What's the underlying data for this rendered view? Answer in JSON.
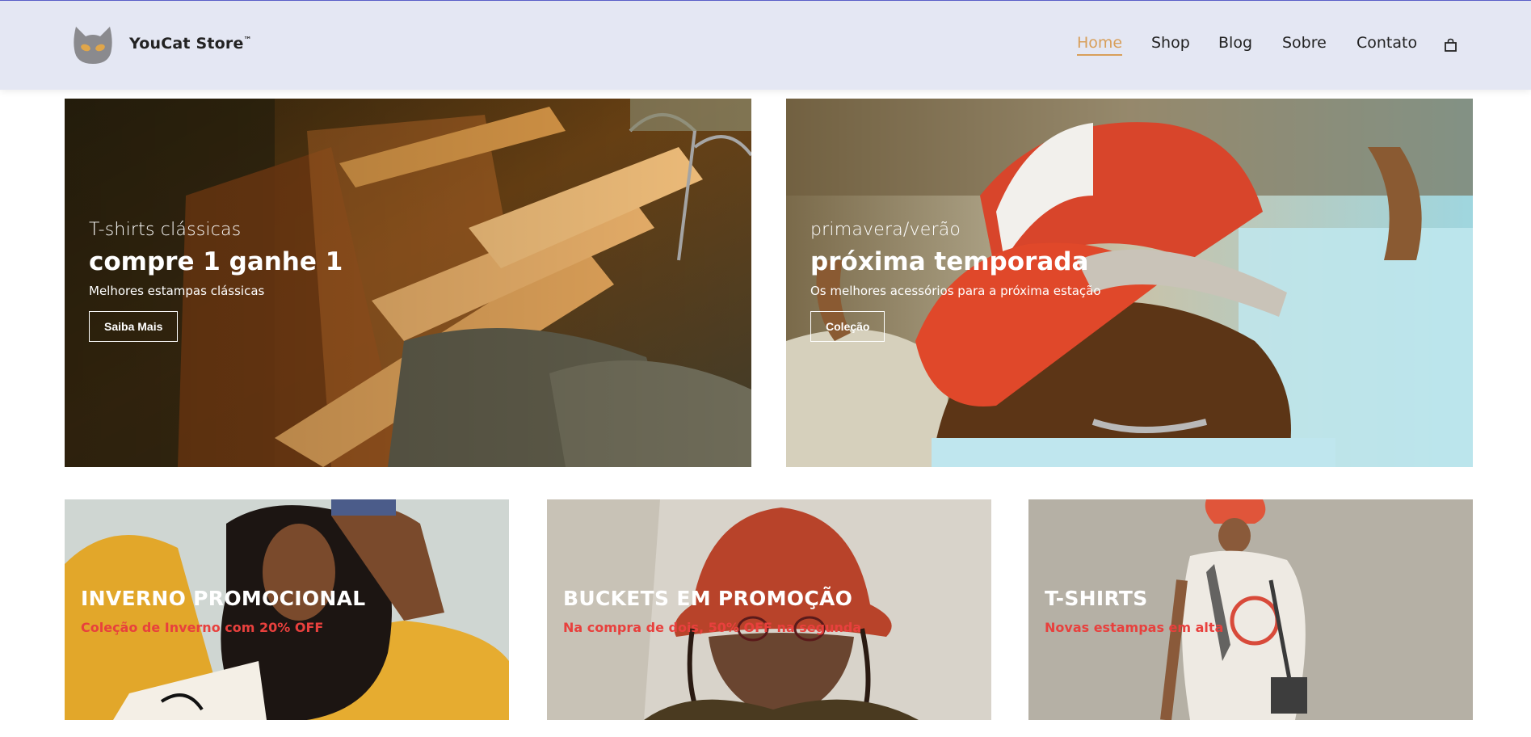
{
  "header": {
    "brand": "YouCat Store",
    "trademark": "™",
    "logo_icon": "cat-head-icon",
    "cart_icon": "shopping-bag-icon",
    "accent_color": "#d89f5a",
    "nav": [
      {
        "label": "Home",
        "active": true
      },
      {
        "label": "Shop",
        "active": false
      },
      {
        "label": "Blog",
        "active": false
      },
      {
        "label": "Sobre",
        "active": false
      },
      {
        "label": "Contato",
        "active": false
      }
    ]
  },
  "banners": [
    {
      "subtitle": "T-shirts clássicas",
      "title": "compre 1 ganhe 1",
      "description": "Melhores estampas clássicas",
      "button": "Saiba Mais"
    },
    {
      "subtitle": "primavera/verão",
      "title": "próxima temporada",
      "description": "Os melhores acessórios para a próxima estação",
      "button": "Coleção"
    }
  ],
  "cards": [
    {
      "title": "INVERNO PROMOCIONAL",
      "description": "Coleção de Inverno com 20% OFF"
    },
    {
      "title": "BUCKETS EM PROMOÇÃO",
      "description": "Na compra de dois, 50% OFF na segunda"
    },
    {
      "title": "T-SHIRTS",
      "description": "Novas estampas em alta"
    }
  ],
  "colors": {
    "header_bg": "#e4e7f3",
    "promo_red": "#e8403d"
  }
}
